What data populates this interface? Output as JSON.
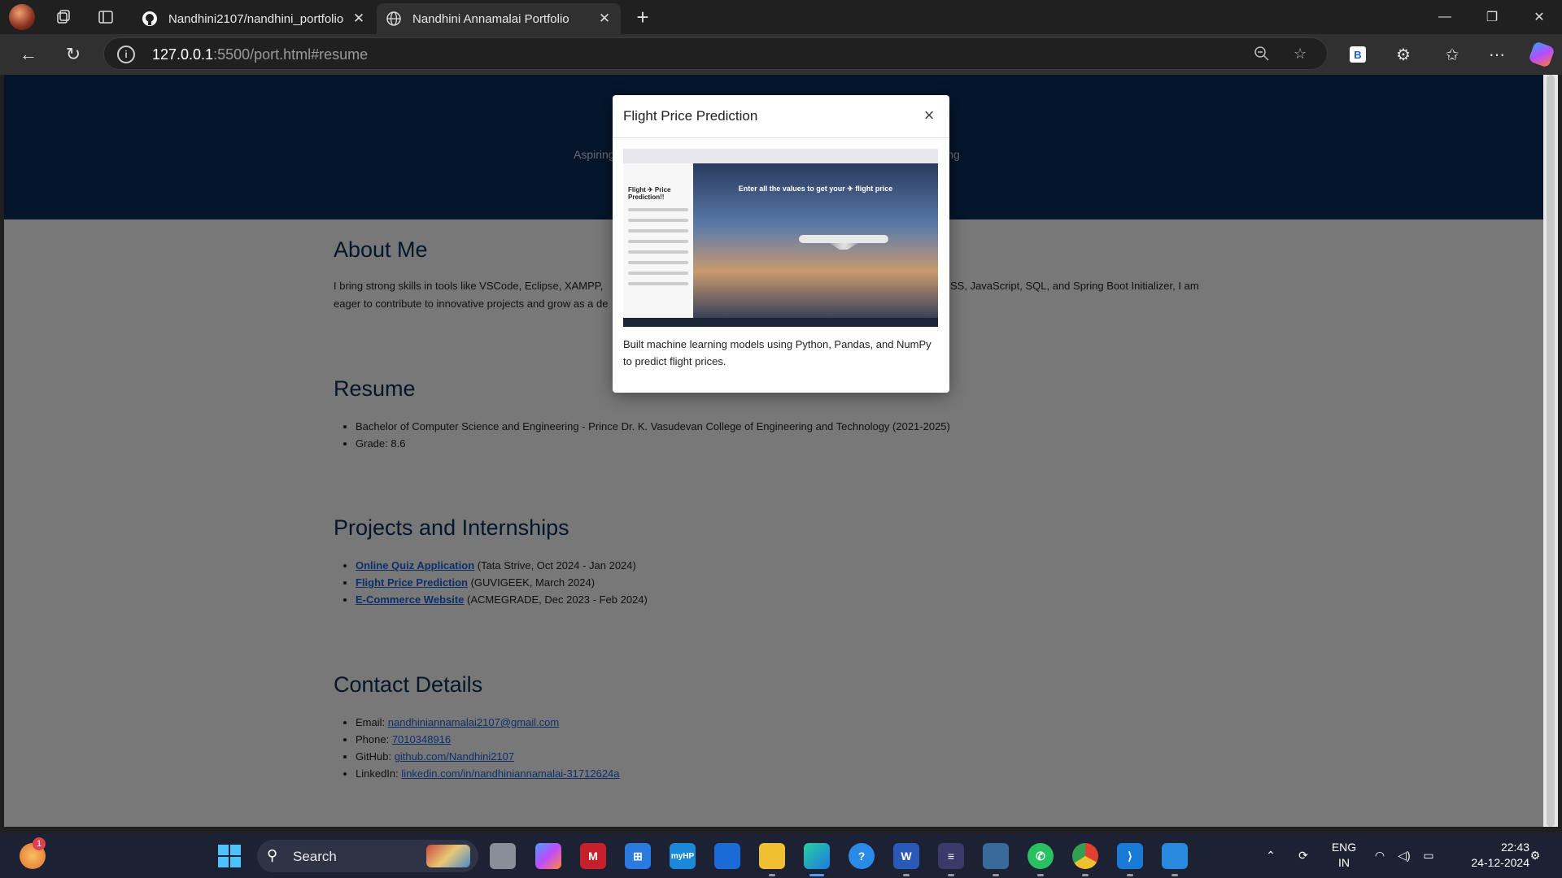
{
  "browser": {
    "tabs": [
      {
        "label": "Nandhini2107/nandhini_portfolio",
        "icon": "github-icon"
      },
      {
        "label": "Nandhini Annamalai Portfolio",
        "icon": "globe-icon"
      }
    ],
    "url_host": "127.0.0.1",
    "url_path": ":5500/port.html#resume",
    "bing_label": "B"
  },
  "page": {
    "hero_subtitle_left": "Aspiring",
    "hero_subtitle_right": "lving",
    "about": {
      "heading": "About Me",
      "text_left_line1": "I bring strong skills in tools like VSCode, Eclipse, XAMPP,",
      "text_right_line1": "SS, JavaScript, SQL, and Spring Boot Initializer, I am",
      "text_line2": "eager to contribute to innovative projects and grow as a de"
    },
    "resume": {
      "heading": "Resume",
      "items": [
        "Bachelor of Computer Science and Engineering - Prince Dr. K. Vasudevan College of Engineering and Technology (2021-2025)",
        "Grade: 8.6"
      ]
    },
    "projects": {
      "heading": "Projects and Internships",
      "items": [
        {
          "link": "Online Quiz Application",
          "detail": " (Tata Strive, Oct 2024 - Jan 2024)"
        },
        {
          "link": "Flight Price Prediction",
          "detail": " (GUVIGEEK, March 2024)"
        },
        {
          "link": "E-Commerce Website",
          "detail": " (ACMEGRADE, Dec 2023 - Feb 2024)"
        }
      ]
    },
    "contact": {
      "heading": "Contact Details",
      "items": [
        {
          "label": "Email: ",
          "value": "nandhiniannamalai2107@gmail.com"
        },
        {
          "label": "Phone: ",
          "value": "7010348916"
        },
        {
          "label": "GitHub: ",
          "value": "github.com/Nandhini2107"
        },
        {
          "label": "LinkedIn: ",
          "value": "linkedin.com/in/nandhiniannamalai-31712624a"
        }
      ]
    }
  },
  "modal": {
    "title": "Flight Price Prediction",
    "close_label": "×",
    "image_header": "Enter all the values to get your ✈ flight price",
    "image_sidebar_title": "Flight ✈ Price Prediction!!",
    "description": "Built machine learning models using Python, Pandas, and NumPy to predict flight prices."
  },
  "taskbar": {
    "search_label": "Search",
    "notification_count": "1",
    "lang_line1": "ENG",
    "lang_line2": "IN",
    "time": "22:43",
    "date": "24-12-2024"
  },
  "colors": {
    "hero_bg": "#0b2a55",
    "heading": "#0b2a55",
    "link": "#1a5fd4",
    "overlay": "rgba(0,0,0,0.5)"
  }
}
